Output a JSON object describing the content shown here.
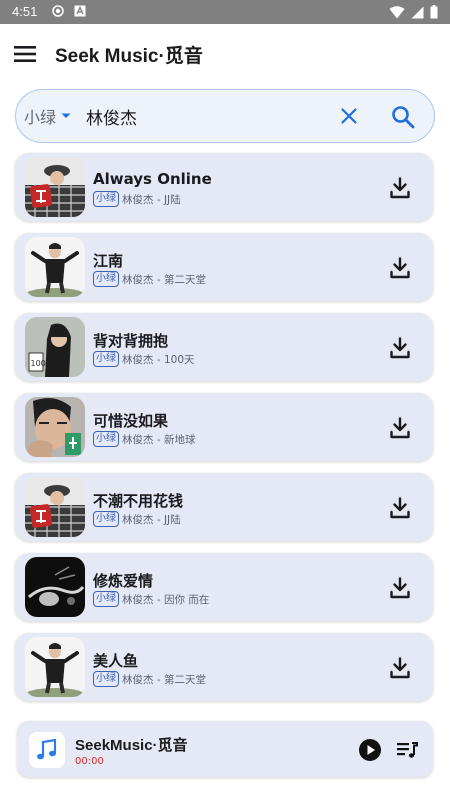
{
  "status_bar": {
    "time": "4:51"
  },
  "app_bar": {
    "title": "Seek Music·觅音"
  },
  "search": {
    "source": "小绿",
    "query": "林俊杰"
  },
  "songs": [
    {
      "title": "Always Online",
      "badge": "小绿",
      "subtitle": "林俊杰 - JJ陆",
      "cover": "jj-lu"
    },
    {
      "title": "江南",
      "badge": "小绿",
      "subtitle": "林俊杰 - 第二天堂",
      "cover": "second-heaven"
    },
    {
      "title": "背对背拥抱",
      "badge": "小绿",
      "subtitle": "林俊杰 - 100天",
      "cover": "100-days"
    },
    {
      "title": "可惜没如果",
      "badge": "小绿",
      "subtitle": "林俊杰 - 新地球",
      "cover": "new-earth"
    },
    {
      "title": "不潮不用花钱",
      "badge": "小绿",
      "subtitle": "林俊杰 - JJ陆",
      "cover": "jj-lu"
    },
    {
      "title": "修炼爱情",
      "badge": "小绿",
      "subtitle": "林俊杰 - 因你 而在",
      "cover": "because-of-you"
    },
    {
      "title": "美人鱼",
      "badge": "小绿",
      "subtitle": "林俊杰 - 第二天堂",
      "cover": "second-heaven"
    }
  ],
  "player": {
    "title": "SeekMusic·觅音",
    "time": "00:00"
  },
  "colors": {
    "accent": "#1e6fd9",
    "card": "#e4e9f5",
    "time_red": "#d32f2f"
  }
}
